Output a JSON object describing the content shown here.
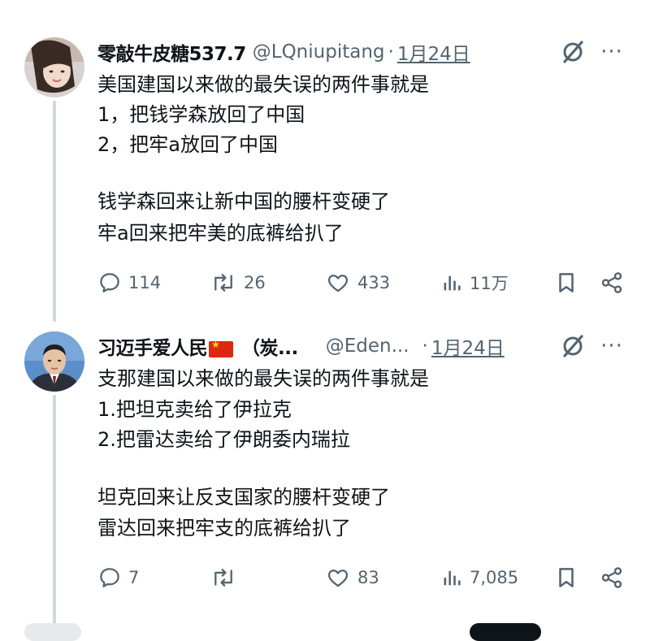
{
  "tweets": [
    {
      "display_name": "零敲牛皮糖537.7",
      "handle": "@LQniupitang",
      "separator": "·",
      "date": "1月24日",
      "more": "···",
      "lines": [
        "美国建国以来做的最失误的两件事就是",
        "1，把钱学森放回了中国",
        "2，把牢a放回了中国",
        "",
        "钱学森回来让新中国的腰杆变硬了",
        "牢a回来把牢美的底裤给扒了"
      ],
      "stats": {
        "replies": "114",
        "reposts": "26",
        "likes": "433",
        "views": "11万"
      }
    },
    {
      "display_name": "习迈手爱人民",
      "name_suffix": "（炭...",
      "handle": "@Eden...",
      "separator": "·",
      "date": "1月24日",
      "more": "···",
      "lines": [
        "支那建国以来做的最失误的两件事就是",
        "1.把坦克卖给了伊拉克",
        "2.把雷达卖给了伊朗委内瑞拉",
        "",
        "坦克回来让反支国家的腰杆变硬了",
        "雷达回来把牢支的底裤给扒了"
      ],
      "stats": {
        "replies": "7",
        "reposts": "",
        "likes": "83",
        "views": "7,085"
      }
    }
  ],
  "icons": [
    "grok-slash-icon",
    "reply-icon",
    "repost-icon",
    "like-icon",
    "views-icon",
    "bookmark-icon",
    "share-icon",
    "china-flag-icon"
  ],
  "colors": {
    "text": "#0f1419",
    "secondary": "#536471",
    "thread_line": "#cfd9de",
    "flag_red": "#de2910",
    "flag_yellow": "#ffde00"
  }
}
